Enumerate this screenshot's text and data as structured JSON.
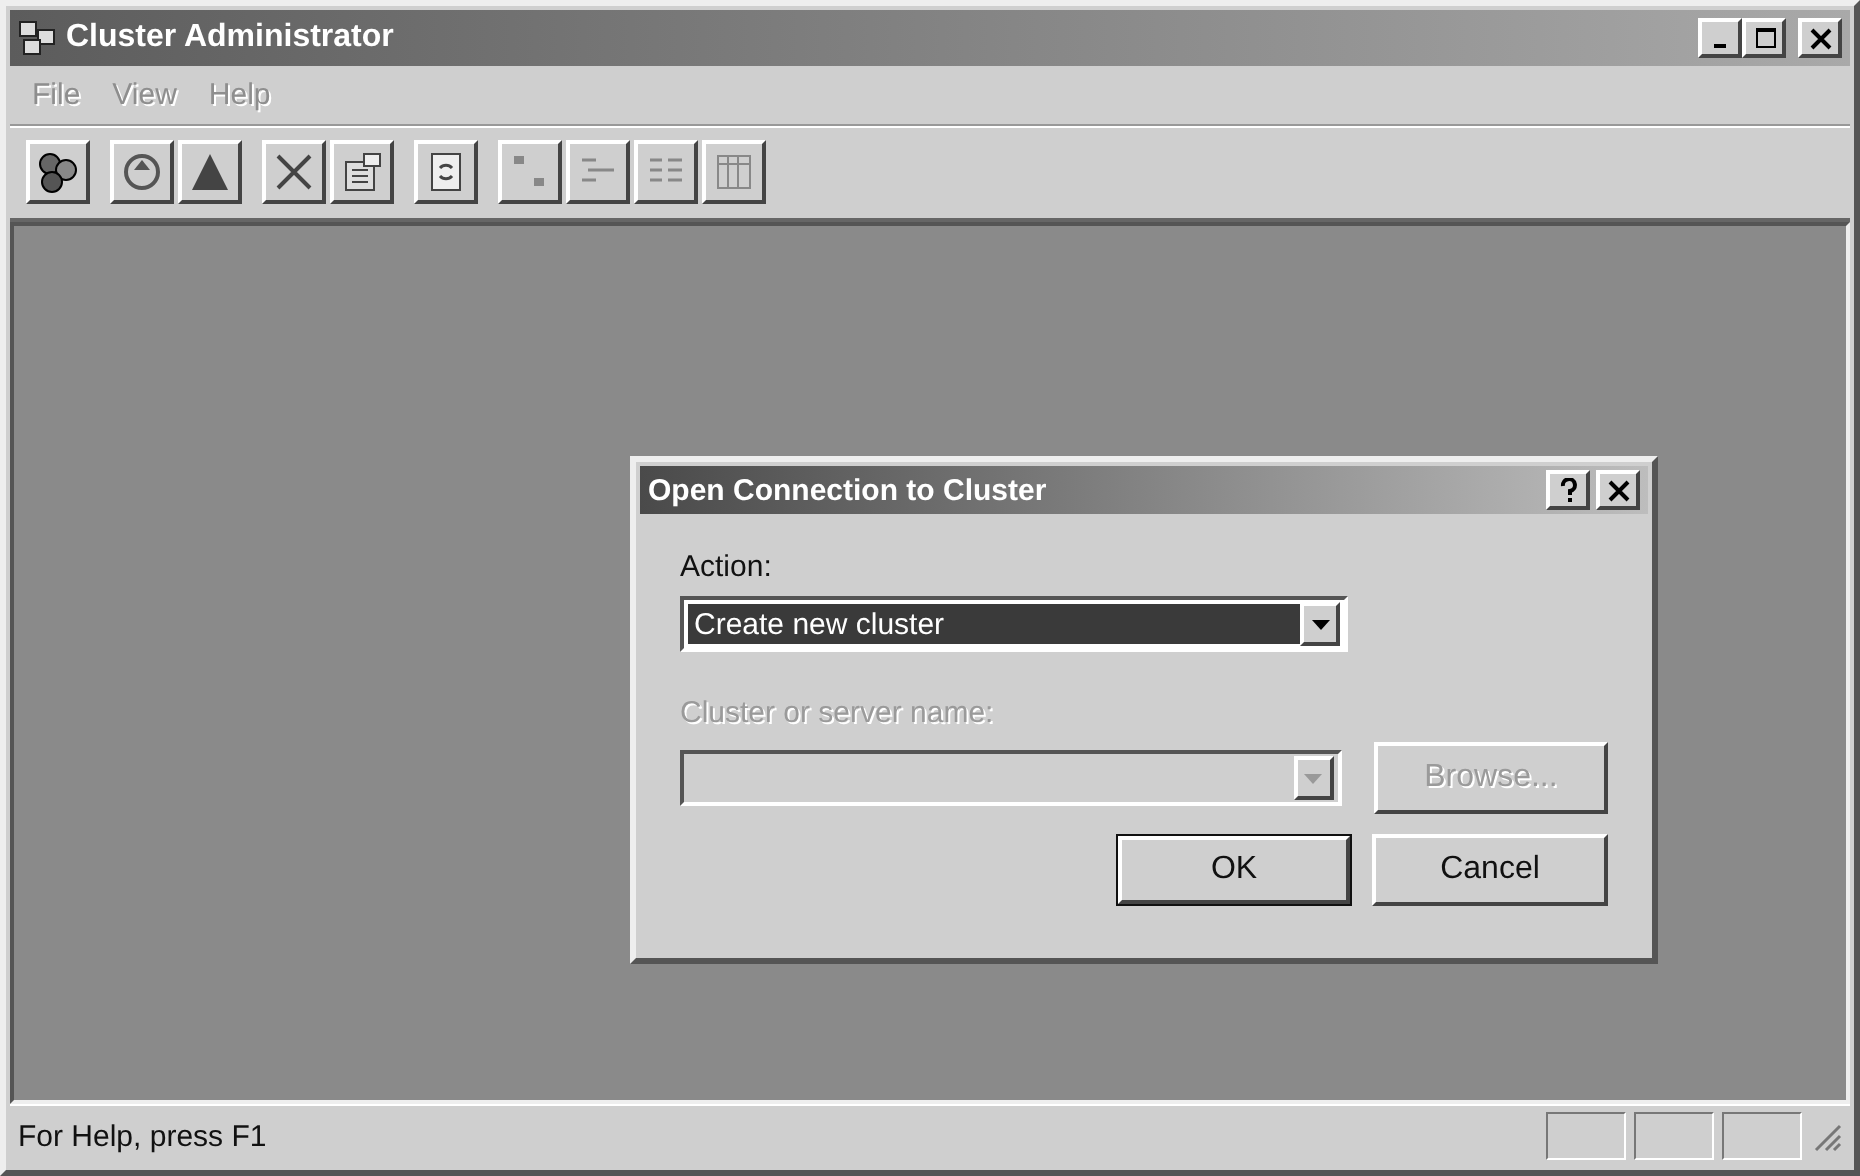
{
  "window": {
    "title": "Cluster Administrator"
  },
  "menu": [
    {
      "label": "File",
      "disabled": true
    },
    {
      "label": "View",
      "disabled": true
    },
    {
      "label": "Help",
      "disabled": true
    }
  ],
  "dialog": {
    "title": "Open Connection to Cluster",
    "action": {
      "label": "Action:",
      "value": "Create new cluster",
      "disabled": false
    },
    "server": {
      "label": "Cluster or server name:",
      "disabled": true
    },
    "buttons": [
      {
        "label": "Browse...",
        "kind": "browse",
        "disabled": true,
        "default": false
      },
      {
        "label": "OK",
        "kind": "ok",
        "disabled": false,
        "default": true
      },
      {
        "label": "Cancel",
        "kind": "cancel",
        "disabled": false,
        "default": false
      }
    ]
  },
  "status_bar": {
    "text": "For Help, press F1"
  }
}
